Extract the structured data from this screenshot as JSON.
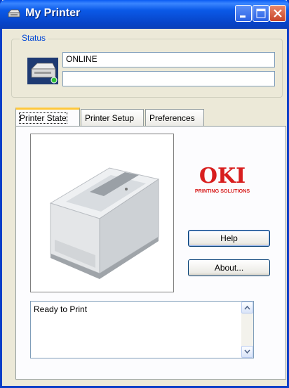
{
  "window": {
    "title": "My Printer"
  },
  "status": {
    "label": "Status",
    "line1": "ONLINE",
    "line2": ""
  },
  "tabs": [
    {
      "label": "Printer State"
    },
    {
      "label": "Printer Setup"
    },
    {
      "label": "Preferences"
    }
  ],
  "buttons": {
    "help": "Help",
    "about": "About..."
  },
  "logo": {
    "brand": "OKI",
    "tagline": "PRINTING SOLUTIONS",
    "color": "#D81E1E"
  },
  "message": {
    "text": "Ready to Print"
  },
  "icons": {
    "title": "printer-icon",
    "status": "printer-status-icon"
  }
}
